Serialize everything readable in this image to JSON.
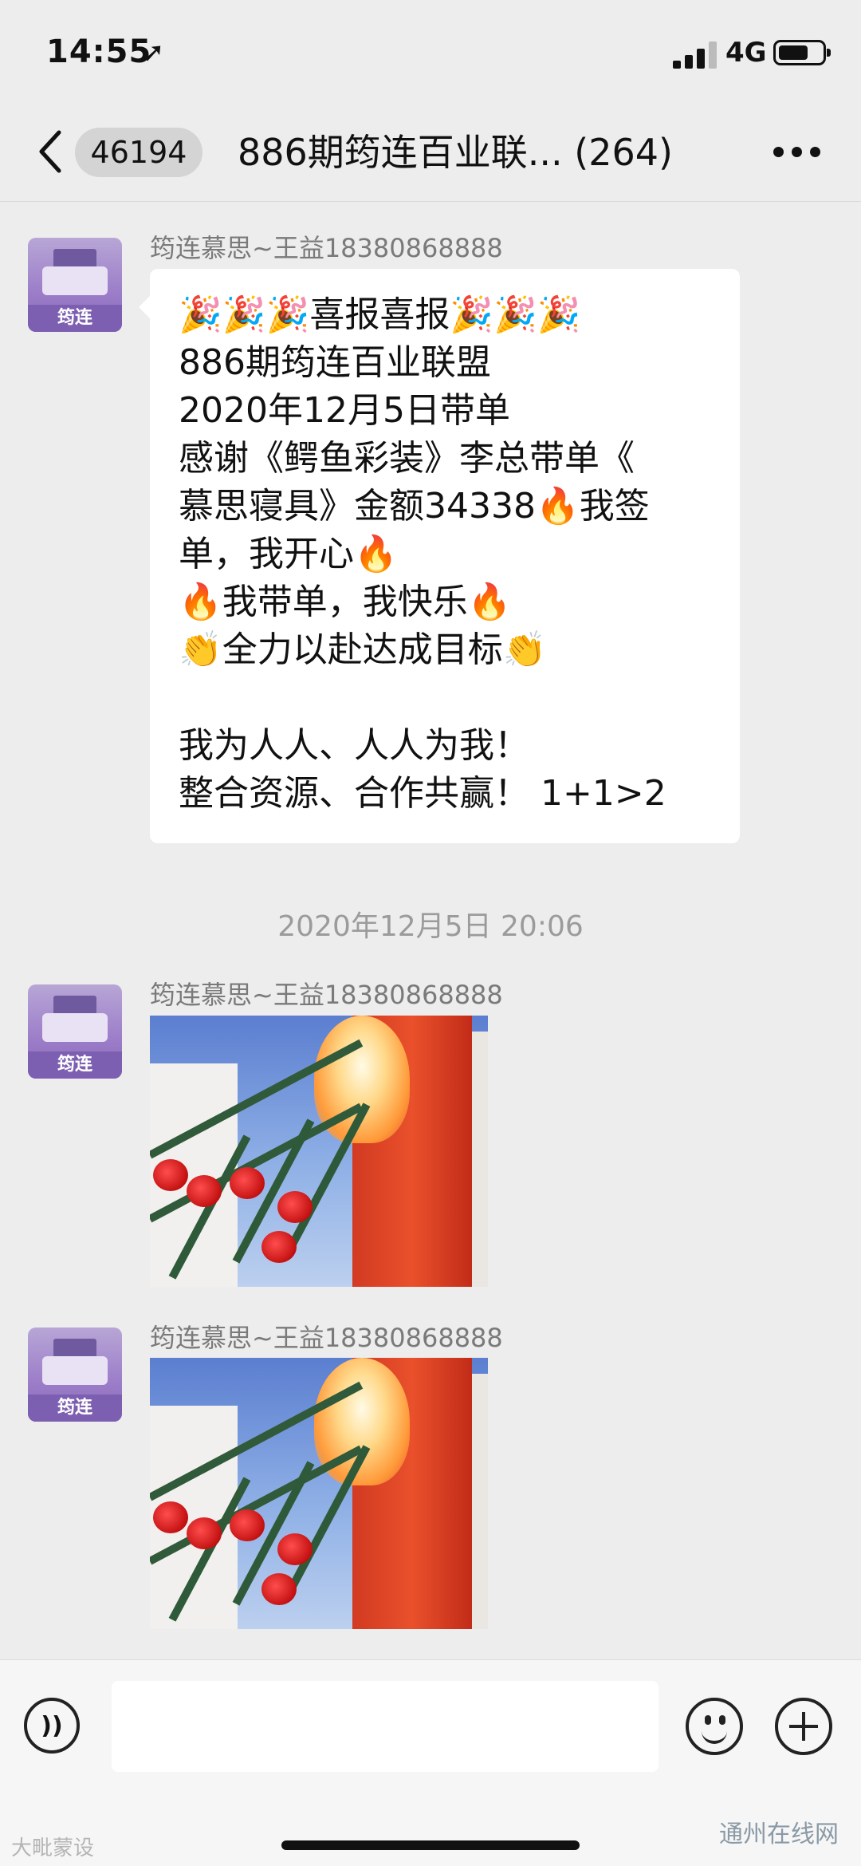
{
  "status_bar": {
    "time": "14:55",
    "network": "4G"
  },
  "nav": {
    "badge": "46194",
    "title": "886期筠连百业联... (264)"
  },
  "messages": [
    {
      "sender": "筠连慕思~王益18380868888",
      "avatar_label": "筠连",
      "text_lines": [
        "🎉🎉🎉喜报喜报🎉🎉🎉",
        "886期筠连百业联盟",
        "2020年12月5日带单",
        "感谢《鳄鱼彩装》李总带单《",
        "慕思寝具》金额34338🔥我签",
        "单，我开心🔥",
        "🔥我带单，我快乐🔥",
        "👏全力以赴达成目标👏",
        "",
        "我为人人、人人为我！",
        "整合资源、合作共赢！ 1+1>2"
      ]
    },
    {
      "sender": "筠连慕思~王益18380868888",
      "avatar_label": "筠连",
      "type": "image"
    },
    {
      "sender": "筠连慕思~王益18380868888",
      "avatar_label": "筠连",
      "type": "image"
    }
  ],
  "timestamp": "2020年12月5日 20:06",
  "input": {
    "placeholder": ""
  },
  "watermarks": {
    "left": "大毗蒙设",
    "right": "通州在线网"
  }
}
